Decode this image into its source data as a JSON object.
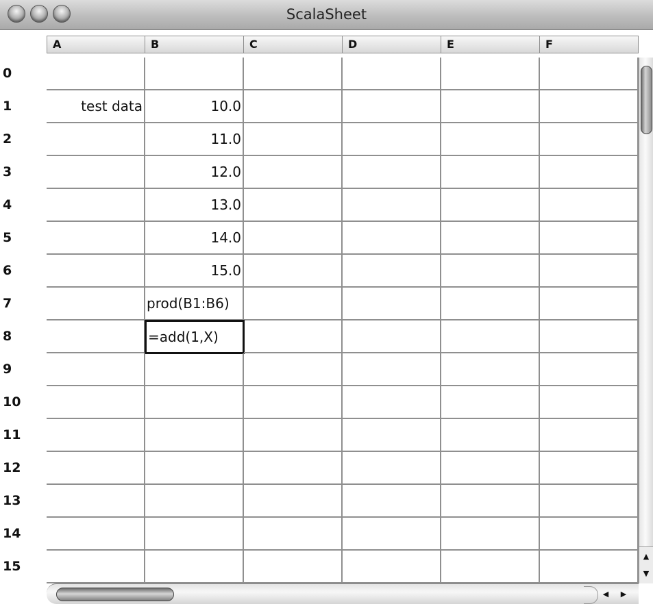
{
  "window": {
    "title": "ScalaSheet"
  },
  "columns": [
    "A",
    "B",
    "C",
    "D",
    "E",
    "F"
  ],
  "rows": [
    "0",
    "1",
    "2",
    "3",
    "4",
    "5",
    "6",
    "7",
    "8",
    "9",
    "10",
    "11",
    "12",
    "13",
    "14",
    "15"
  ],
  "cells": [
    [
      "",
      "",
      "",
      "",
      "",
      ""
    ],
    [
      "test data",
      "10.0",
      "",
      "",
      "",
      ""
    ],
    [
      "",
      "11.0",
      "",
      "",
      "",
      ""
    ],
    [
      "",
      "12.0",
      "",
      "",
      "",
      ""
    ],
    [
      "",
      "13.0",
      "",
      "",
      "",
      ""
    ],
    [
      "",
      "14.0",
      "",
      "",
      "",
      ""
    ],
    [
      "",
      "15.0",
      "",
      "",
      "",
      ""
    ],
    [
      "",
      "prod(B1:B6)",
      "",
      "",
      "",
      ""
    ],
    [
      "",
      "=add(1,X)",
      "",
      "",
      "",
      ""
    ],
    [
      "",
      "",
      "",
      "",
      "",
      ""
    ],
    [
      "",
      "",
      "",
      "",
      "",
      ""
    ],
    [
      "",
      "",
      "",
      "",
      "",
      ""
    ],
    [
      "",
      "",
      "",
      "",
      "",
      ""
    ],
    [
      "",
      "",
      "",
      "",
      "",
      ""
    ],
    [
      "",
      "",
      "",
      "",
      "",
      ""
    ],
    [
      "",
      "",
      "",
      "",
      "",
      ""
    ]
  ],
  "selected_cell": "B8",
  "icons": {
    "scroll_up": "▲",
    "scroll_down": "▼",
    "scroll_left": "◀",
    "scroll_right": "▶"
  }
}
